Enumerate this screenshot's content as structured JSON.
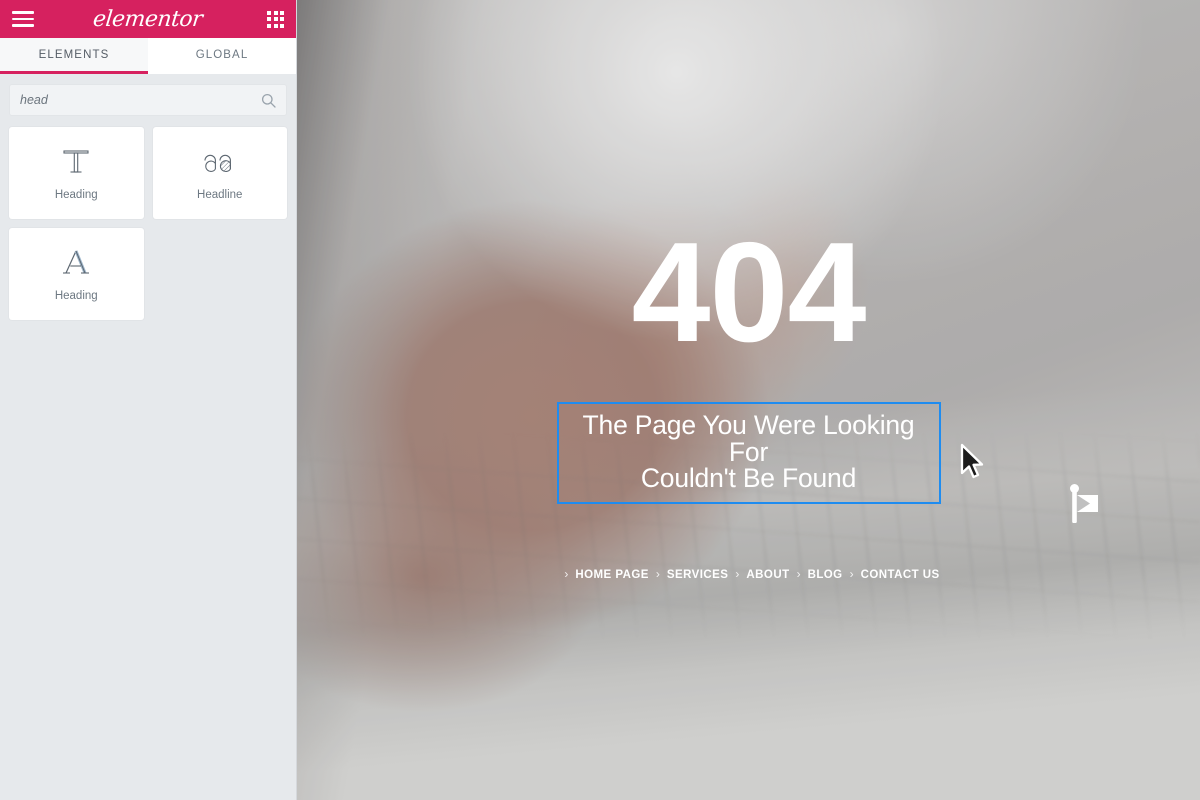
{
  "panel": {
    "header": {
      "menu_icon": "hamburger-icon",
      "logo_text": "elementor",
      "apps_icon": "grid-apps-icon"
    },
    "tabs": [
      {
        "label": "ELEMENTS",
        "active": true
      },
      {
        "label": "GLOBAL",
        "active": false
      }
    ],
    "search": {
      "value": "head",
      "placeholder": "Search Widget...",
      "icon": "search-icon"
    },
    "widgets": [
      {
        "label": "Heading",
        "icon": "t-letter-icon"
      },
      {
        "label": "Headline",
        "icon": "aa-letters-icon"
      },
      {
        "label": "Heading",
        "icon": "a-serif-icon"
      }
    ]
  },
  "canvas": {
    "error_code": "404",
    "headline": "The Page You Were Looking For\nCouldn't Be Found",
    "nav": {
      "separator": "›",
      "links": [
        "HOME PAGE",
        "SERVICES",
        "ABOUT",
        "BLOG",
        "CONTACT US"
      ]
    },
    "marker_icon": "flag-marker-icon",
    "cursor_icon": "mouse-pointer-icon"
  },
  "colors": {
    "brand_pink": "#d6215f",
    "selection_blue": "#1e8cf0",
    "panel_bg": "#e6e9ec",
    "card_bg": "#ffffff",
    "text_muted": "#6d7882"
  }
}
